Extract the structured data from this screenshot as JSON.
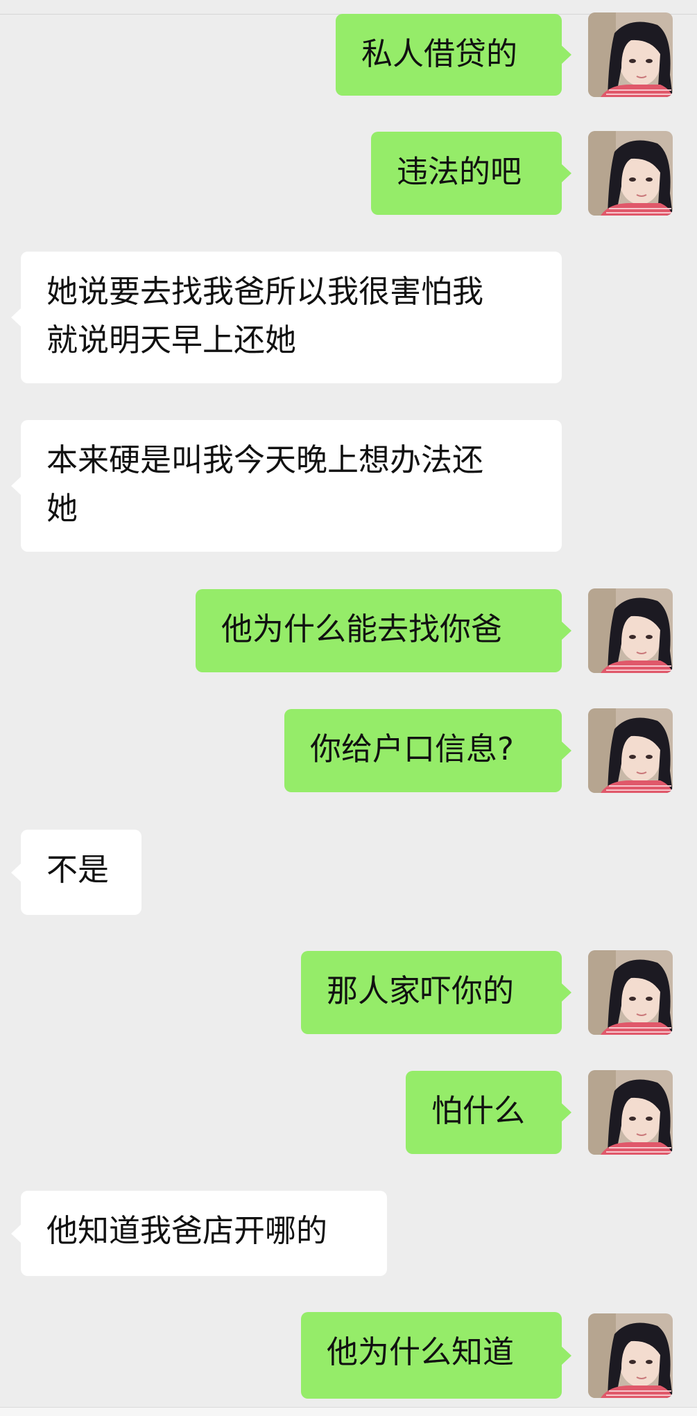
{
  "messages": [
    {
      "side": "out",
      "text": "私人借贷的"
    },
    {
      "side": "out",
      "text": "违法的吧"
    },
    {
      "side": "in",
      "text": "她说要去找我爸所以我很害怕我\n就说明天早上还她"
    },
    {
      "side": "in",
      "text": "本来硬是叫我今天晚上想办法还\n她"
    },
    {
      "side": "out",
      "text": "他为什么能去找你爸"
    },
    {
      "side": "out",
      "text": "你给户口信息?"
    },
    {
      "side": "in",
      "text": "不是"
    },
    {
      "side": "out",
      "text": "那人家吓你的"
    },
    {
      "side": "out",
      "text": "怕什么"
    },
    {
      "side": "in",
      "text": "他知道我爸店开哪的"
    },
    {
      "side": "out",
      "text": "他为什么知道"
    }
  ],
  "icons": {
    "avatar": "user-avatar-photo"
  },
  "colors": {
    "background": "#ededed",
    "outgoing_bubble": "#95ec69",
    "incoming_bubble": "#ffffff",
    "text": "#111111"
  }
}
